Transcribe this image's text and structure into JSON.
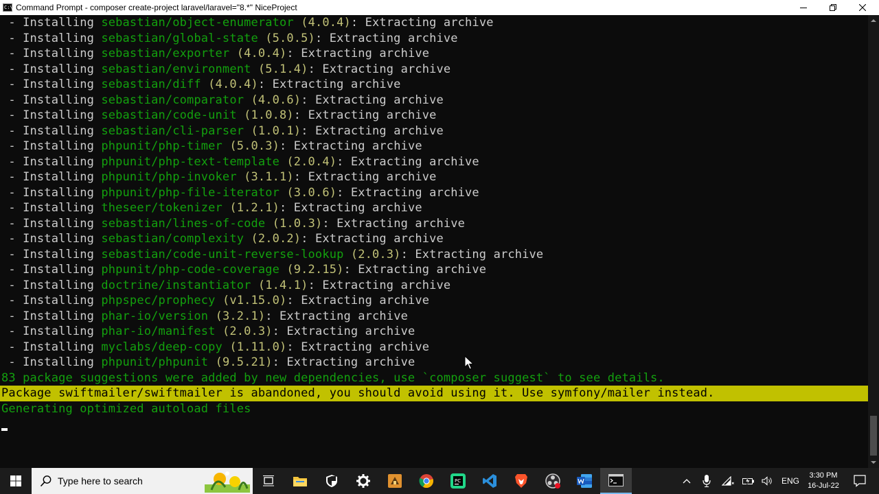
{
  "window": {
    "title": "Command Prompt - composer  create-project laravel/laravel=\"8.*\" NiceProject",
    "icon_text": "C:\\"
  },
  "console": {
    "install_prefix": " - Installing ",
    "install_suffix": ": Extracting archive",
    "installs": [
      {
        "pkg": "sebastian/object-enumerator",
        "ver": "(4.0.4)"
      },
      {
        "pkg": "sebastian/global-state",
        "ver": "(5.0.5)"
      },
      {
        "pkg": "sebastian/exporter",
        "ver": "(4.0.4)"
      },
      {
        "pkg": "sebastian/environment",
        "ver": "(5.1.4)"
      },
      {
        "pkg": "sebastian/diff",
        "ver": "(4.0.4)"
      },
      {
        "pkg": "sebastian/comparator",
        "ver": "(4.0.6)"
      },
      {
        "pkg": "sebastian/code-unit",
        "ver": "(1.0.8)"
      },
      {
        "pkg": "sebastian/cli-parser",
        "ver": "(1.0.1)"
      },
      {
        "pkg": "phpunit/php-timer",
        "ver": "(5.0.3)"
      },
      {
        "pkg": "phpunit/php-text-template",
        "ver": "(2.0.4)"
      },
      {
        "pkg": "phpunit/php-invoker",
        "ver": "(3.1.1)"
      },
      {
        "pkg": "phpunit/php-file-iterator",
        "ver": "(3.0.6)"
      },
      {
        "pkg": "theseer/tokenizer",
        "ver": "(1.2.1)"
      },
      {
        "pkg": "sebastian/lines-of-code",
        "ver": "(1.0.3)"
      },
      {
        "pkg": "sebastian/complexity",
        "ver": "(2.0.2)"
      },
      {
        "pkg": "sebastian/code-unit-reverse-lookup",
        "ver": "(2.0.3)"
      },
      {
        "pkg": "phpunit/php-code-coverage",
        "ver": "(9.2.15)"
      },
      {
        "pkg": "doctrine/instantiator",
        "ver": "(1.4.1)"
      },
      {
        "pkg": "phpspec/prophecy",
        "ver": "(v1.15.0)"
      },
      {
        "pkg": "phar-io/version",
        "ver": "(3.2.1)"
      },
      {
        "pkg": "phar-io/manifest",
        "ver": "(2.0.3)"
      },
      {
        "pkg": "myclabs/deep-copy",
        "ver": "(1.11.0)"
      },
      {
        "pkg": "phpunit/phpunit",
        "ver": "(9.5.21)"
      }
    ],
    "suggestions": "83 package suggestions were added by new dependencies, use `composer suggest` to see details.",
    "warning": "Package swiftmailer/swiftmailer is abandoned, you should avoid using it. Use symfony/mailer instead.",
    "autoload": "Generating optimized autoload files"
  },
  "colors": {
    "console_bg": "#0c0c0c",
    "console_text": "#cccccc",
    "package_green": "#13a10e",
    "version_yellow": "#c1c177",
    "warning_bg": "#c1c100",
    "taskbar_bg": "#1c1c1c"
  },
  "taskbar": {
    "search_placeholder": "Type here to search",
    "apps": [
      "task-view-icon",
      "file-explorer-icon",
      "security-shield-icon",
      "settings-gear-icon",
      "package-app-icon",
      "chrome-icon",
      "pycharm-icon",
      "vscode-icon",
      "brave-icon",
      "obs-icon",
      "word-icon",
      "command-prompt-icon"
    ],
    "language": "ENG",
    "time": "3:30 PM",
    "date": "16-Jul-22"
  }
}
